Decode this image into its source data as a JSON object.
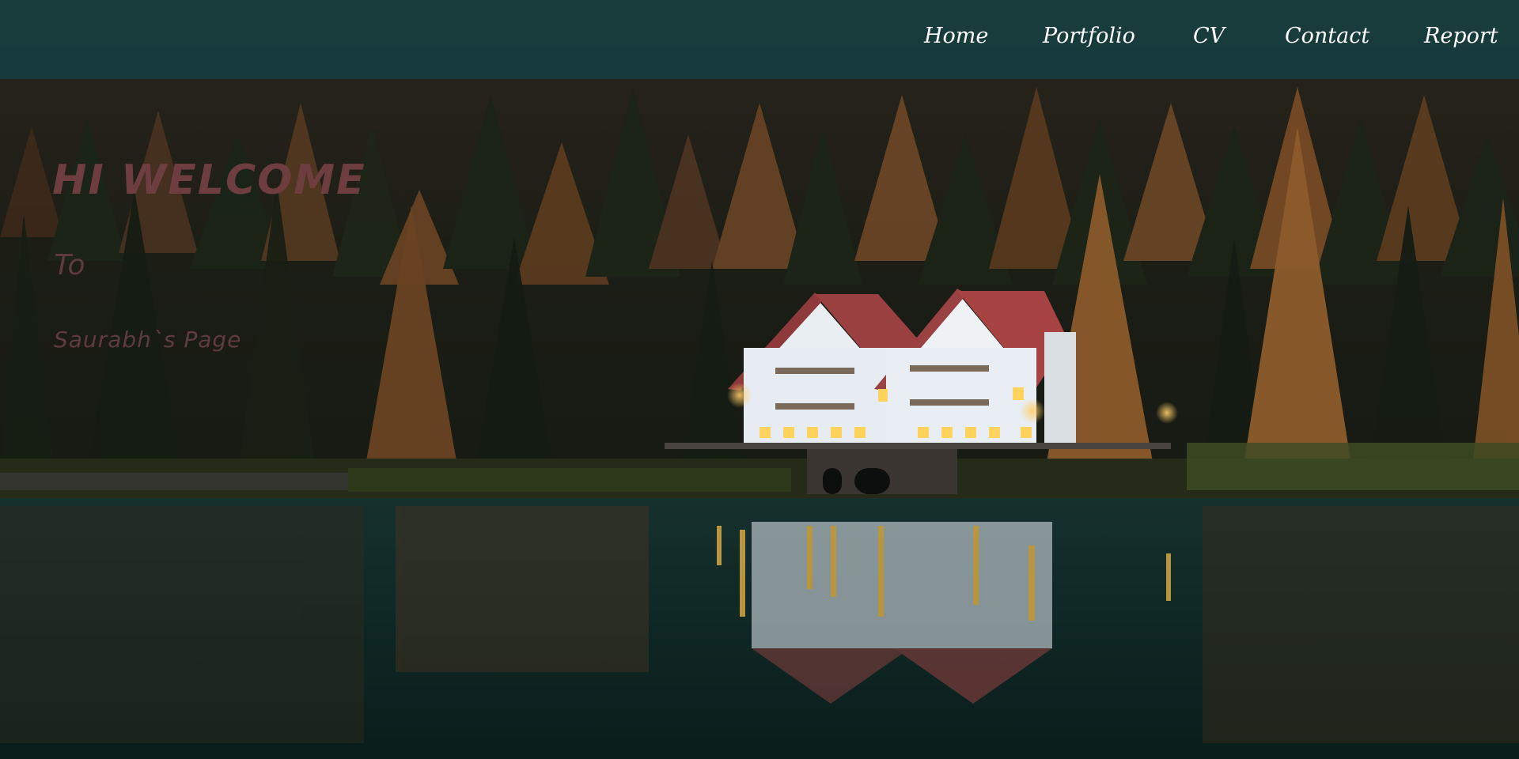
{
  "nav": {
    "items": [
      {
        "label": "Home"
      },
      {
        "label": "Portfolio"
      },
      {
        "label": "CV"
      },
      {
        "label": "Contact"
      },
      {
        "label": "Report"
      }
    ]
  },
  "hero": {
    "title": "HI WELCOME",
    "subtitle": "To",
    "name": "Saurabh`s Page"
  },
  "colors": {
    "navbar": "#163e40",
    "hero_text": "#6e3d3f",
    "nav_text": "#ffffff"
  }
}
